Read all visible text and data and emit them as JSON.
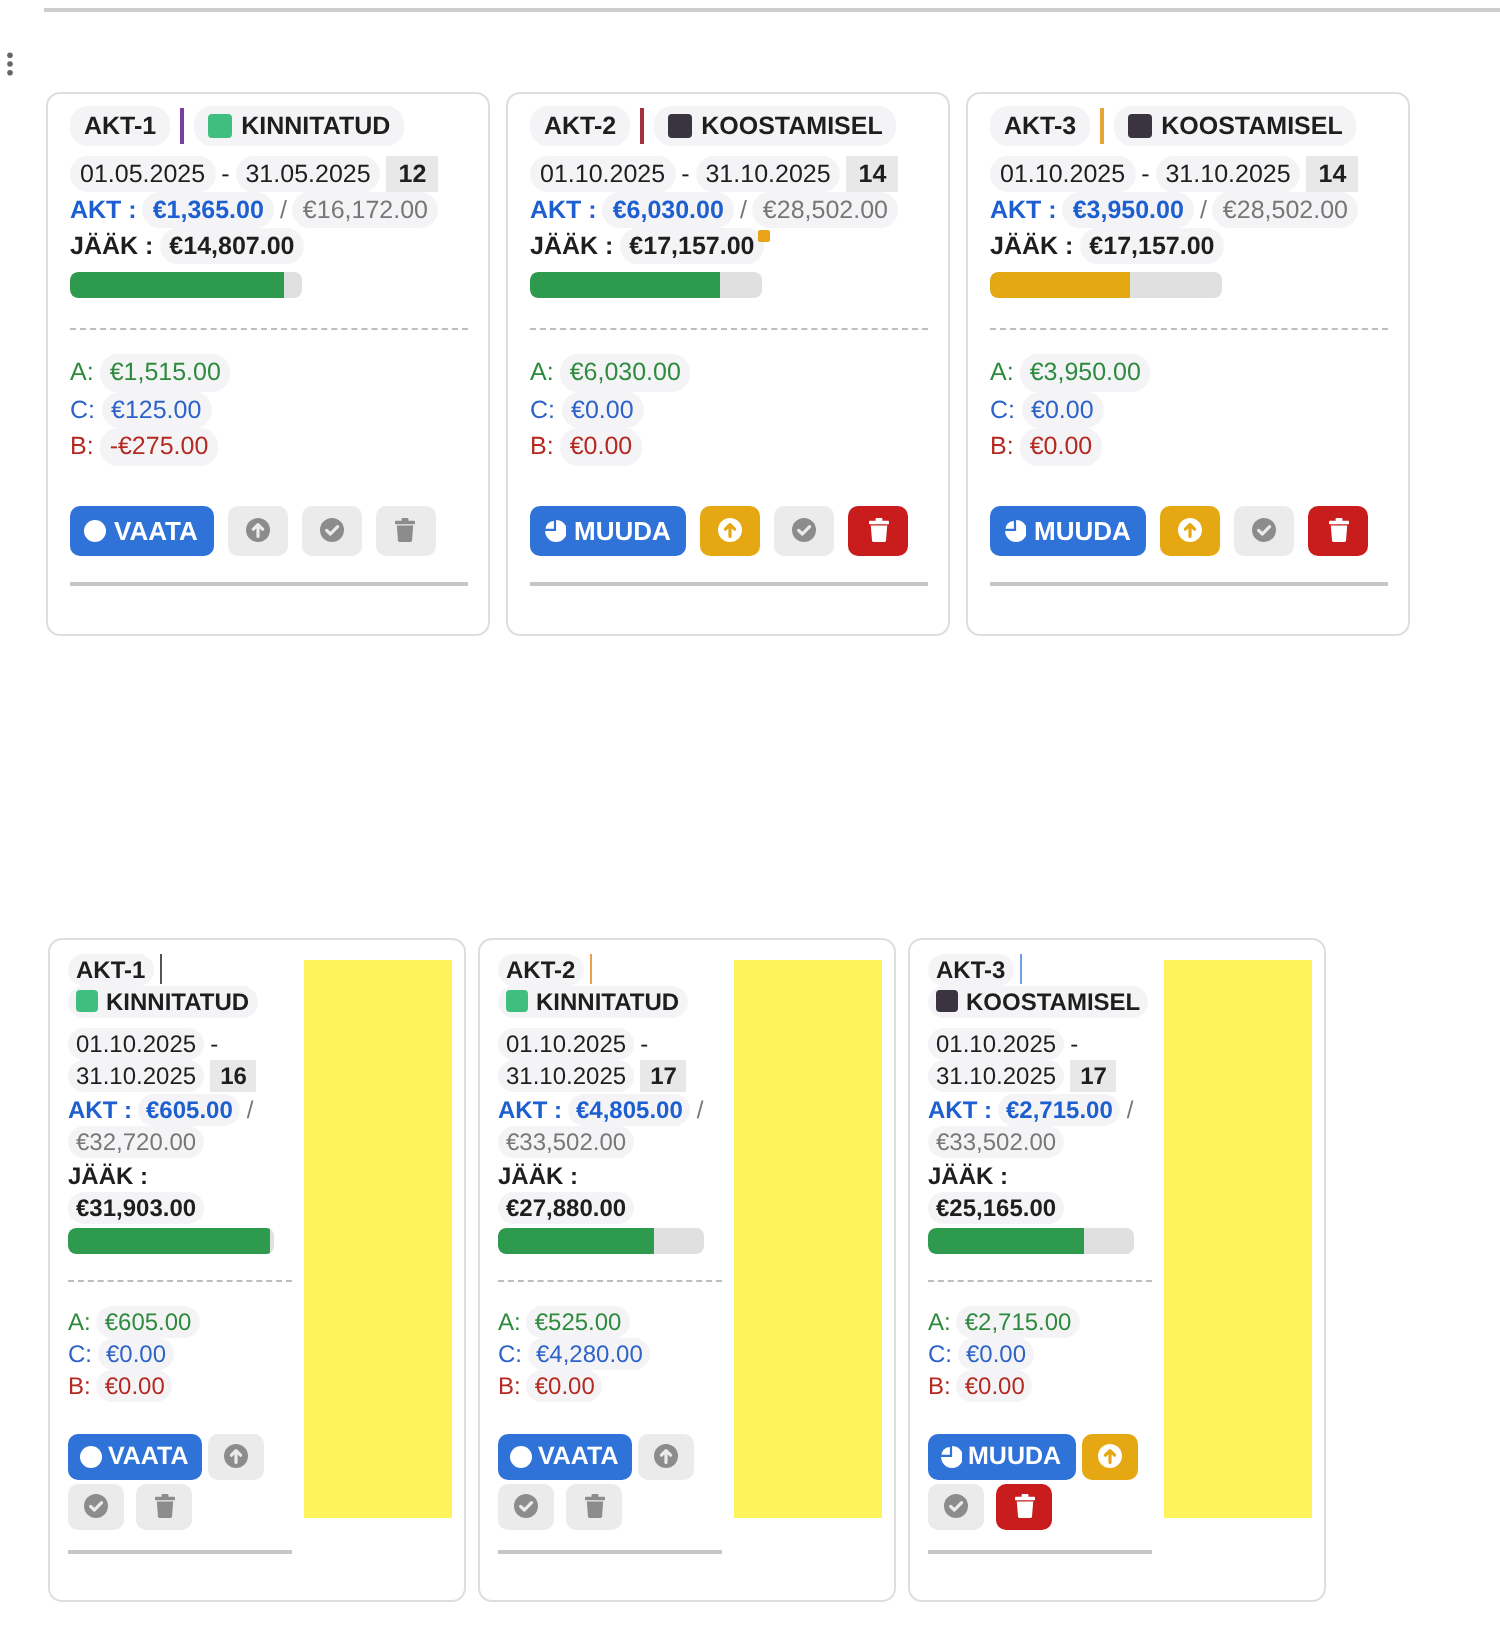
{
  "top_cards": [
    {
      "code": "AKT-1",
      "separator": {
        "color": "#7b3f9e"
      },
      "status": {
        "label": "KINNITATUD",
        "color": "#3fbf7f"
      },
      "period": {
        "start": "01.05.2025",
        "dash": "-",
        "end": "31.05.2025",
        "days": "12"
      },
      "akt": {
        "label": "AKT :",
        "value": "€1,365.00",
        "slash": "/",
        "total": "€16,172.00"
      },
      "jaak": {
        "label": "JÄÄK :",
        "value": "€14,807.00",
        "flagged": false
      },
      "progress": {
        "level": 0.92,
        "color": "#2e9a4e"
      },
      "breakdown": [
        {
          "label": "A:",
          "value": "€1,515.00",
          "color": "#2e8b3e"
        },
        {
          "label": "C:",
          "value": "€125.00",
          "color": "#2d63c8"
        },
        {
          "label": "B:",
          "value": "-€275.00",
          "color": "#b42a22"
        }
      ],
      "actions": [
        {
          "kind": "view",
          "label": "VAATA"
        },
        {
          "kind": "upload",
          "disabled": true
        },
        {
          "kind": "approve",
          "disabled": true
        },
        {
          "kind": "delete",
          "disabled": true
        }
      ]
    },
    {
      "code": "AKT-2",
      "separator": {
        "color": "#a3303a"
      },
      "status": {
        "label": "KOOSTAMISEL",
        "color": "#3a3440"
      },
      "period": {
        "start": "01.10.2025",
        "dash": "-",
        "end": "31.10.2025",
        "days": "14"
      },
      "akt": {
        "label": "AKT :",
        "value": "€6,030.00",
        "slash": "/",
        "total": "€28,502.00"
      },
      "jaak": {
        "label": "JÄÄK :",
        "value": "€17,157.00",
        "flagged": true
      },
      "progress": {
        "level": 0.82,
        "color": "#2e9a4e"
      },
      "breakdown": [
        {
          "label": "A:",
          "value": "€6,030.00",
          "color": "#2e8b3e"
        },
        {
          "label": "C:",
          "value": "€0.00",
          "color": "#2d63c8"
        },
        {
          "label": "B:",
          "value": "€0.00",
          "color": "#b42a22"
        }
      ],
      "actions": [
        {
          "kind": "edit",
          "label": "MUUDA"
        },
        {
          "kind": "upload",
          "disabled": false
        },
        {
          "kind": "approve",
          "disabled": true
        },
        {
          "kind": "delete",
          "disabled": false
        }
      ]
    },
    {
      "code": "AKT-3",
      "separator": {
        "color": "#e8a23a"
      },
      "status": {
        "label": "KOOSTAMISEL",
        "color": "#3a3440"
      },
      "period": {
        "start": "01.10.2025",
        "dash": "-",
        "end": "31.10.2025",
        "days": "14"
      },
      "akt": {
        "label": "AKT :",
        "value": "€3,950.00",
        "slash": "/",
        "total": "€28,502.00"
      },
      "jaak": {
        "label": "JÄÄK :",
        "value": "€17,157.00",
        "flagged": false
      },
      "progress": {
        "level": 0.6,
        "color": "#e4a812"
      },
      "breakdown": [
        {
          "label": "A:",
          "value": "€3,950.00",
          "color": "#2e8b3e"
        },
        {
          "label": "C:",
          "value": "€0.00",
          "color": "#2d63c8"
        },
        {
          "label": "B:",
          "value": "€0.00",
          "color": "#b42a22"
        }
      ],
      "actions": [
        {
          "kind": "edit",
          "label": "MUUDA"
        },
        {
          "kind": "upload",
          "disabled": false
        },
        {
          "kind": "approve",
          "disabled": true
        },
        {
          "kind": "delete",
          "disabled": false
        }
      ]
    }
  ],
  "bottom_cards": [
    {
      "code": "AKT-1",
      "separator": {
        "color": "#555555"
      },
      "status": {
        "label": "KINNITATUD",
        "color": "#3fbf7f"
      },
      "period": {
        "start": "01.10.2025",
        "dash": "-",
        "end": "31.10.2025",
        "days": "16"
      },
      "akt": {
        "label": "AKT :",
        "value": "€605.00",
        "slash": "/",
        "total": "€32,720.00"
      },
      "jaak": {
        "label": "JÄÄK :",
        "value": "€31,903.00",
        "flagged": false
      },
      "progress": {
        "level": 0.98,
        "color": "#2e9a4e"
      },
      "breakdown": [
        {
          "label": "A:",
          "value": "€605.00",
          "color": "#2e8b3e"
        },
        {
          "label": "C:",
          "value": "€0.00",
          "color": "#2d63c8"
        },
        {
          "label": "B:",
          "value": "€0.00",
          "color": "#b42a22"
        }
      ],
      "actions": [
        {
          "kind": "view",
          "label": "VAATA"
        },
        {
          "kind": "upload",
          "disabled": true
        },
        {
          "kind": "approve",
          "disabled": true
        },
        {
          "kind": "delete",
          "disabled": true
        }
      ],
      "side_panel": true
    },
    {
      "code": "AKT-2",
      "separator": {
        "color": "#eda04c"
      },
      "status": {
        "label": "KINNITATUD",
        "color": "#3fbf7f"
      },
      "period": {
        "start": "01.10.2025",
        "dash": "-",
        "end": "31.10.2025",
        "days": "17"
      },
      "akt": {
        "label": "AKT :",
        "value": "€4,805.00",
        "slash": "/",
        "total": "€33,502.00"
      },
      "jaak": {
        "label": "JÄÄK :",
        "value": "€27,880.00",
        "flagged": false
      },
      "progress": {
        "level": 0.76,
        "color": "#2e9a4e"
      },
      "breakdown": [
        {
          "label": "A:",
          "value": "€525.00",
          "color": "#2e8b3e"
        },
        {
          "label": "C:",
          "value": "€4,280.00",
          "color": "#2d63c8"
        },
        {
          "label": "B:",
          "value": "€0.00",
          "color": "#b42a22"
        }
      ],
      "actions": [
        {
          "kind": "view",
          "label": "VAATA"
        },
        {
          "kind": "upload",
          "disabled": true
        },
        {
          "kind": "approve",
          "disabled": true
        },
        {
          "kind": "delete",
          "disabled": true
        }
      ],
      "side_panel": true
    },
    {
      "code": "AKT-3",
      "separator": {
        "color": "#6f9fe4"
      },
      "status": {
        "label": "KOOSTAMISEL",
        "color": "#3a3440"
      },
      "period": {
        "start": "01.10.2025",
        "dash": "-",
        "end": "31.10.2025",
        "days": "17"
      },
      "akt": {
        "label": "AKT :",
        "value": "€2,715.00",
        "slash": "/",
        "total": "€33,502.00"
      },
      "jaak": {
        "label": "JÄÄK :",
        "value": "€25,165.00",
        "flagged": false
      },
      "progress": {
        "level": 0.76,
        "color": "#2e9a4e"
      },
      "breakdown": [
        {
          "label": "A:",
          "value": "€2,715.00",
          "color": "#2e8b3e"
        },
        {
          "label": "C:",
          "value": "€0.00",
          "color": "#2d63c8"
        },
        {
          "label": "B:",
          "value": "€0.00",
          "color": "#b42a22"
        }
      ],
      "actions": [
        {
          "kind": "edit",
          "label": "MUUDA"
        },
        {
          "kind": "upload",
          "disabled": false
        },
        {
          "kind": "approve",
          "disabled": true
        },
        {
          "kind": "delete",
          "disabled": false
        }
      ],
      "side_panel": true
    }
  ]
}
